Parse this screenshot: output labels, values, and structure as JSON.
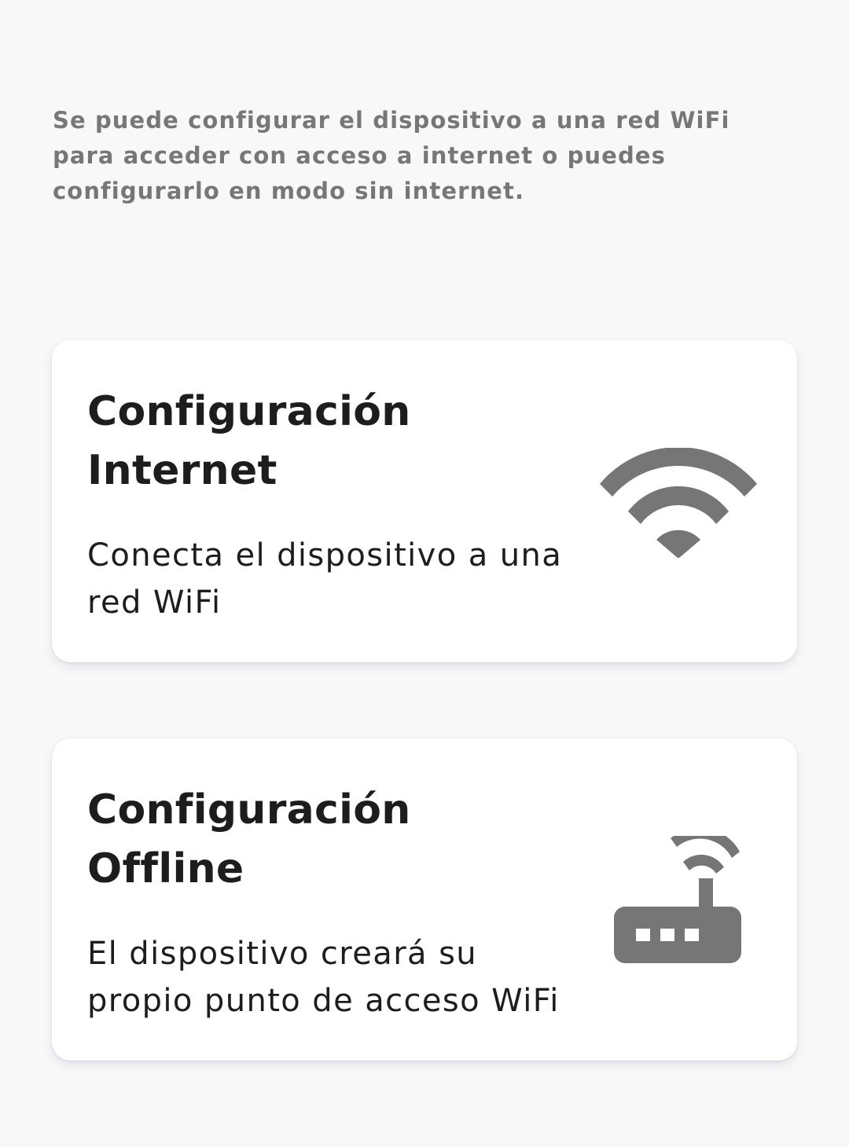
{
  "intro": {
    "text": "Se puede configurar el dispositivo a una red WiFi para acceder con acceso a internet o puedes configurarlo en modo sin internet."
  },
  "options": {
    "internet": {
      "title_line1": "Configuración",
      "title_line2": "Internet",
      "description": "Conecta el dispositivo a una red WiFi",
      "icon": "wifi-icon"
    },
    "offline": {
      "title_line1": "Configuración",
      "title_line2": "Offline",
      "description": "El dispositivo creará su propio punto de acceso WiFi",
      "icon": "router-icon"
    }
  },
  "colors": {
    "background": "#f8f8f9",
    "card": "#ffffff",
    "icon": "#767676",
    "title": "#1d1d1d",
    "intro_text": "#777777"
  }
}
